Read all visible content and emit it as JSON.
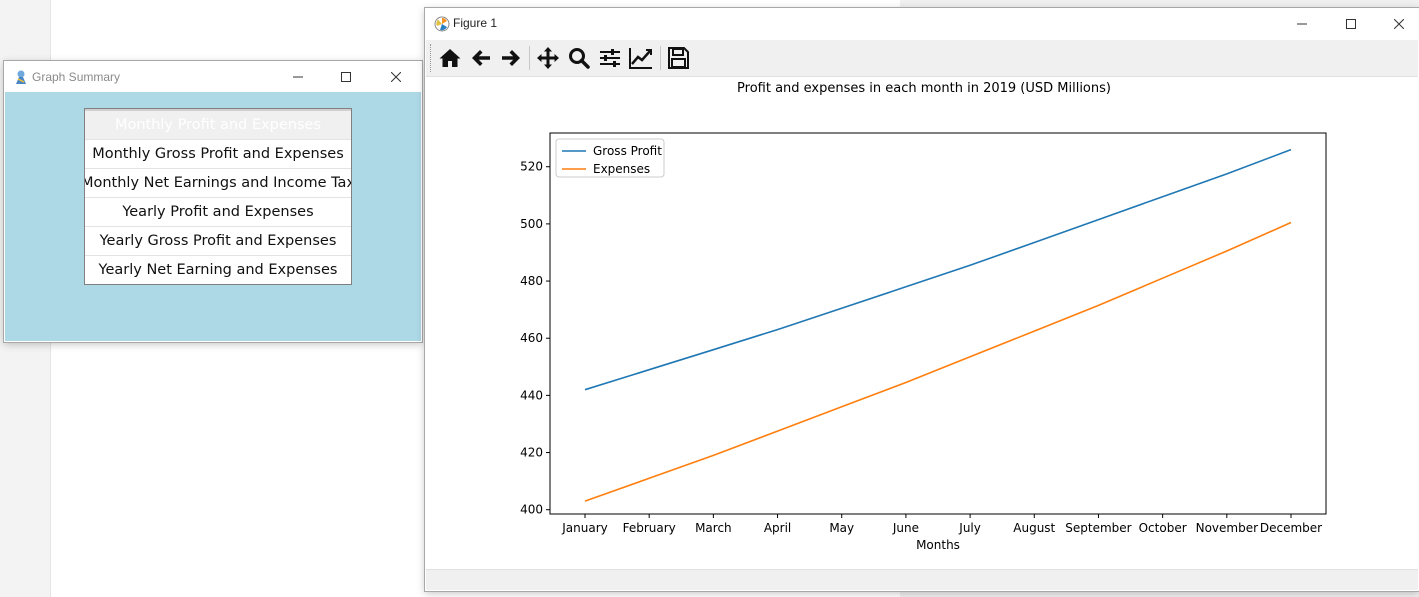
{
  "graph_summary": {
    "title": "Graph Summary",
    "buttons": [
      "Monthly Profit and Expenses",
      "Monthly Gross Profit and Expenses",
      "Monthly Net Earnings and Income Tax",
      "Yearly Profit and Expenses",
      "Yearly Gross Profit and Expenses",
      "Yearly Net Earning and Expenses"
    ],
    "active_index": 0,
    "background_color": "#add8e6"
  },
  "figure": {
    "title": "Figure 1",
    "toolbar": [
      "home-icon",
      "back-icon",
      "forward-icon",
      "pan-icon",
      "zoom-icon",
      "configure-subplots-icon",
      "edit-axes-icon",
      "save-icon"
    ]
  },
  "chart_data": {
    "type": "line",
    "title": "Profit and expenses in each month in 2019 (USD Millions)",
    "xlabel": "Months",
    "ylabel": "",
    "categories": [
      "January",
      "February",
      "March",
      "April",
      "May",
      "June",
      "July",
      "August",
      "September",
      "October",
      "November",
      "December"
    ],
    "series": [
      {
        "name": "Gross Profit",
        "color": "#1f77b4",
        "values": [
          442,
          449,
          456,
          463,
          470.5,
          478,
          485.5,
          493.5,
          501.5,
          509.5,
          517.5,
          526
        ]
      },
      {
        "name": "Expenses",
        "color": "#ff7f0e",
        "values": [
          403,
          411,
          419,
          427.5,
          436,
          444.5,
          453.5,
          462.5,
          471.5,
          481,
          490.5,
          500.5
        ]
      }
    ],
    "ylim": [
      398.5,
      531.8
    ],
    "yticks": [
      400,
      420,
      440,
      460,
      480,
      500,
      520
    ],
    "legend": "top-left",
    "grid": false
  }
}
